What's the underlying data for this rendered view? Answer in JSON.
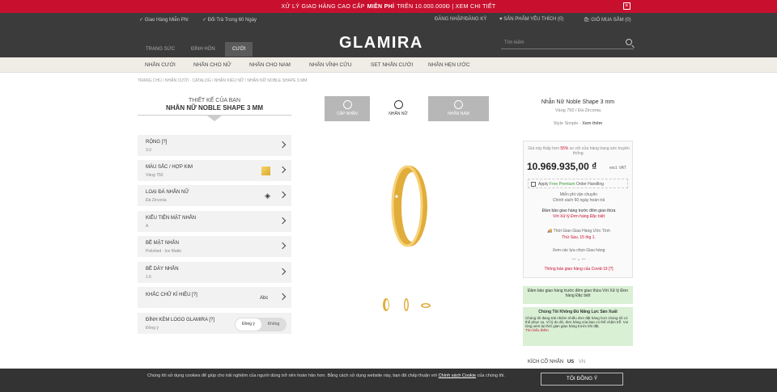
{
  "topbar": {
    "prefix": "XỬ LÝ GIAO HÀNG CAO CẤP",
    "bold": "MIỄN PHÍ",
    "suffix": "TRÊN 10.000.000Đ | XEM CHI TIẾT",
    "close": "×"
  },
  "header": {
    "free_ship": "✓ Giao Hàng Miễn Phí",
    "returns": "✓ Đổi Trả Trong 60 Ngày",
    "login": "ĐĂNG NHẬP/ĐĂNG KÝ",
    "wishlist": "♥ SẢN PHẨM YÊU THÍCH (0)",
    "cart": "GIỎ MUA SẮM (0)",
    "tabs": [
      "TRANG SỨC",
      "ĐÍNH HÔN",
      "CƯỚI"
    ],
    "logo": "GLAMIRA",
    "search_placeholder": "Tìm kiếm"
  },
  "subnav": [
    "NHẪN CƯỚI",
    "NHẪN CHO NỮ",
    "NHẪN CHO NAM",
    "NHẪN VĨNH CỬU",
    "SET NHẪN CƯỚI",
    "NHẪN HẸN ƯỚC"
  ],
  "breadcrumb": "TRANG CHỦ / NHẪN CƯỚI · CATALOG / NHẪN KIỂU NỮ / NHẪN NỮ NOBLE SHAPE 3 MM",
  "design": {
    "title": "THIẾT KẾ CỦA BẠN",
    "name": "NHẪN NỮ NOBLE SHAPE 3 MM"
  },
  "options": [
    {
      "title": "RỘNG   [?]",
      "value": "3.0"
    },
    {
      "title": "MÀU SẮC / HỢP KIM",
      "value": "Vàng 750"
    },
    {
      "title": "LOẠI ĐÁ NHẪN NỮ",
      "value": "Đá Zirconia"
    },
    {
      "title": "KIỂU TIỆN MẶT NHẪN",
      "value": "A"
    },
    {
      "title": "BỀ MẶT NHẪN",
      "value": "Polished · Ice Matte"
    },
    {
      "title": "BỀ DÀY NHẪN",
      "value": "1.6"
    },
    {
      "title": "KHẮC CHỮ KÍ HIỆU   [?]",
      "value": ""
    },
    {
      "title": "ĐÍNH KÈM LOGO GLAMIRA   [?]",
      "value": "Đồng ý"
    }
  ],
  "engrave_value": "Abc",
  "toggle": {
    "on": "Đồng ý",
    "off": "Không"
  },
  "product_tabs": [
    "CẶP NHẪN",
    "NHẪN NỮ",
    "NHẪN NAM"
  ],
  "product": {
    "name": "Nhẫn Nữ Noble Shape 3 mm",
    "sub": "Vàng 750 / Đá Zirconia",
    "style_label": "Style Simple - ",
    "style_link": "Xem thêm",
    "note_prefix": "Giá này thấp hơn ",
    "note_pct": "55%",
    "note_suffix": " so với cửa hàng trang sức truyền thống.",
    "price": "10.969.935,00 ₫",
    "vat": "excl. VAT",
    "premium_prefix": "Apply ",
    "premium_free": "Free Premium",
    "premium_suffix": " Order Handling",
    "returns": "Miễn phí vận chuyển",
    "returns2": "Chính sách 60 ngày hoàn trả",
    "guarantee": "Đảm bảo giao hàng trước đêm giao thừa",
    "guarantee2": "Với Xử lý Đơn hàng Đặc biệt",
    "delivery": "Thời Gian Giao Hàng Ước Tính",
    "delivery_date": "Thứ Sáu, 15 thg 1.",
    "more": "Xem các lựa chọn Giao hàng",
    "covid": "Thông báo giao hàng của Covid-19 [?]"
  },
  "green1": "Đảm bảo giao hàng trước đêm giao thừa\nVới Xử lý Đơn hàng Đặc biệt",
  "green2": {
    "title": "Chúng Tôi Không Đủ Năng Lực Sản Xuất",
    "body": "Chúng tôi đang trải nhiệm nhiều đơn đặt hàng hơn chúng tôi có thể phục vụ. Vì lý do đó, đơn hàng của bạn có thể chậm trễ. Vui lòng xem lại thời gian giao hàng trước khi đặt.",
    "link": "Tìm hiểu thêm"
  },
  "size": {
    "label": "KÍCH CỠ NHẪN",
    "us": "US",
    "vn": "VN"
  },
  "cookie": {
    "text": "Chúng tôi sử dụng cookies để giúp cho trải nghiệm của người dùng trở nên hoàn hảo hơn. Bằng cách sử dụng website này, bạn đã chấp thuận với ",
    "link": "Chính sách Cookie",
    "tail": " của chúng tôi.",
    "button": "TÔI ĐỒNG Ý"
  }
}
